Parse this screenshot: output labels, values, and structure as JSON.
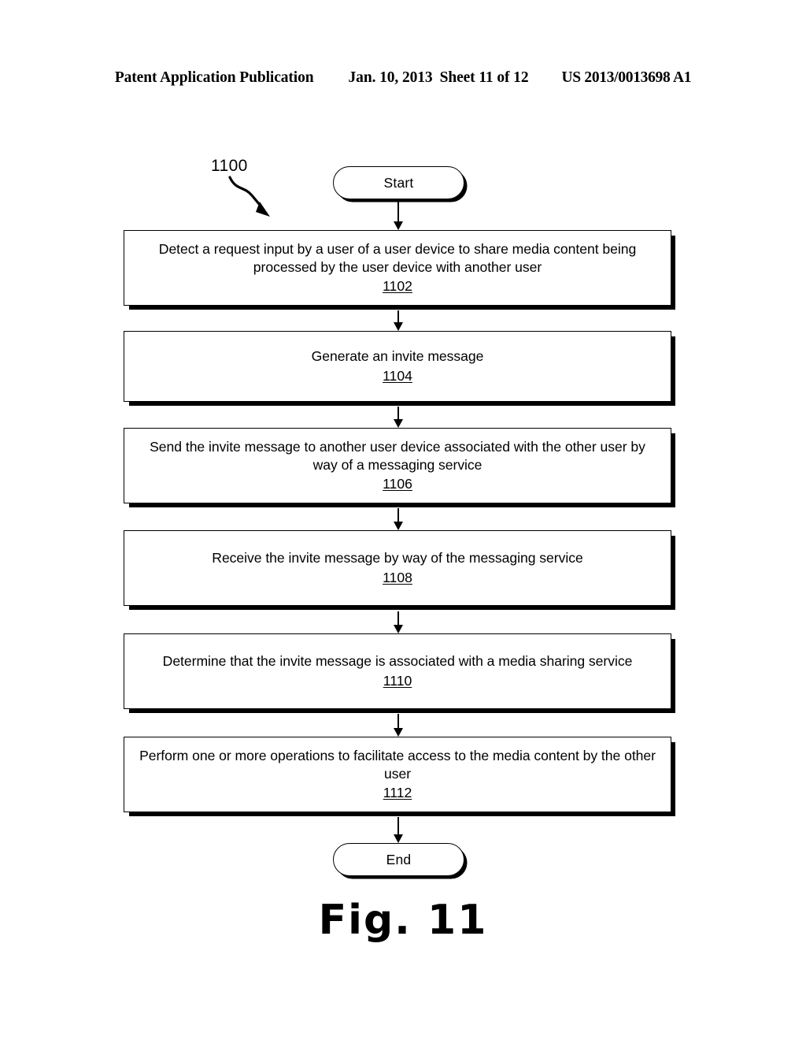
{
  "header": {
    "publication": "Patent Application Publication",
    "date": "Jan. 10, 2013",
    "sheet": "Sheet 11 of 12",
    "number": "US 2013/0013698 A1"
  },
  "figure": {
    "caption": "Fig. 11",
    "diagram_reference": "1100"
  },
  "flowchart": {
    "type": "flowchart",
    "orientation": "top-to-bottom",
    "start_label": "Start",
    "end_label": "End",
    "steps": [
      {
        "ref": "1102",
        "text": "Detect a request input by a user of a user device to share media content being processed by the user device with another user"
      },
      {
        "ref": "1104",
        "text": "Generate an invite message"
      },
      {
        "ref": "1106",
        "text": "Send the invite message to another user device associated with the other user by way of a messaging service"
      },
      {
        "ref": "1108",
        "text": "Receive the invite message by way of the messaging service"
      },
      {
        "ref": "1110",
        "text": "Determine that the invite message is associated with a media sharing service"
      },
      {
        "ref": "1112",
        "text": "Perform one or more operations to facilitate access to the media content by the other user"
      }
    ]
  },
  "colors": {
    "ink": "#000000",
    "paper": "#ffffff"
  }
}
